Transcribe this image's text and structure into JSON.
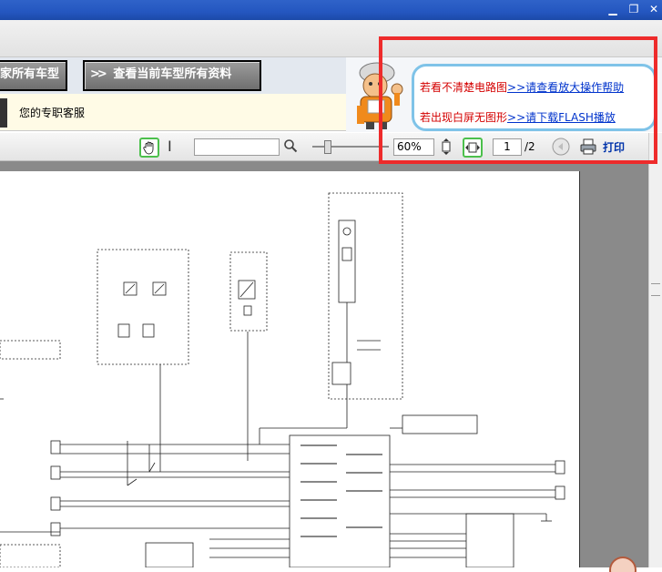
{
  "buttons": {
    "all_models_label": "家所有车型",
    "current_model_label": "查看当前车型所有资料"
  },
  "service": {
    "label": "您的专职客服"
  },
  "help": {
    "line1_prefix": "若看不清楚电路图",
    "line1_link": ">>请查看放大操作帮助",
    "line2_prefix": "若出现白屏无图形",
    "line2_link": ">>请下载FLASH播放"
  },
  "toolbar": {
    "search_placeholder": "",
    "zoom_value": "60%",
    "page_current": "1",
    "page_total": "/2",
    "print_label": "打印"
  },
  "colors": {
    "highlight": "#ee2b2b",
    "toolbar_accent": "#4cc04c"
  },
  "icons": [
    "hand-tool-icon",
    "text-cursor-icon",
    "search-icon",
    "fit-height-icon",
    "fit-width-icon",
    "back-icon",
    "printer-icon",
    "mascot-icon",
    "minimize-icon",
    "maximize-icon",
    "close-icon"
  ]
}
